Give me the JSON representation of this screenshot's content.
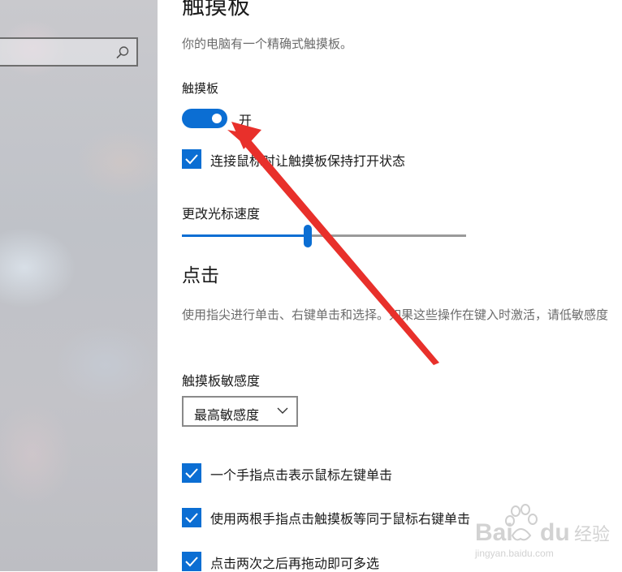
{
  "sidebar": {
    "search_placeholder": ""
  },
  "header": {
    "title": "触摸板",
    "description": "你的电脑有一个精确式触摸板。"
  },
  "touchpad": {
    "label": "触摸板",
    "toggle_state": "开",
    "keep_on_with_mouse": {
      "label": "连接鼠标时让触摸板保持打开状态",
      "checked": true
    }
  },
  "cursor_speed": {
    "label": "更改光标速度",
    "value_fraction": 0.44
  },
  "taps": {
    "heading": "点击",
    "description": "使用指尖进行单击、右键单击和选择。如果这些操作在键入时激活，请低敏感度",
    "sensitivity_label": "触摸板敏感度",
    "sensitivity_value": "最高敏感度",
    "options": [
      {
        "label": "一个手指点击表示鼠标左键单击",
        "checked": true
      },
      {
        "label": "使用两根手指点击触摸板等同于鼠标右键单击",
        "checked": true
      },
      {
        "label": "点击两次之后再拖动即可多选",
        "checked": true
      }
    ]
  },
  "watermark": {
    "brand": "Bai",
    "brand2": "du",
    "site_cn": "经验",
    "url": "jingyan.baidu.com"
  },
  "colors": {
    "accent": "#0b6ed3",
    "annotation": "#e8302b"
  }
}
